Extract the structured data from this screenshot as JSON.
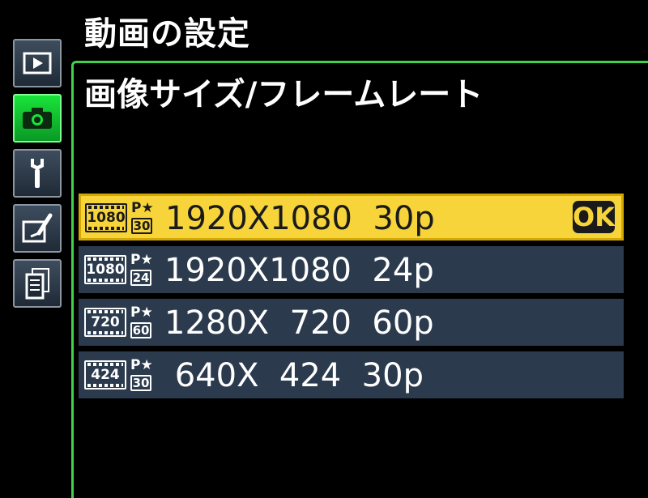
{
  "header": {
    "title": "動画の設定"
  },
  "subtitle": "画像サイズ/フレームレート",
  "tabs": [
    {
      "icon": "playback-icon",
      "active": false
    },
    {
      "icon": "camera-icon",
      "active": true
    },
    {
      "icon": "wrench-icon",
      "active": false
    },
    {
      "icon": "retouch-icon",
      "active": false
    },
    {
      "icon": "list-icon",
      "active": false
    }
  ],
  "options": [
    {
      "resolution_badge": "1080",
      "frame_rate_badge": "30",
      "star": "P★",
      "label": "1920X1080  30p",
      "selected": true,
      "confirm": "OK"
    },
    {
      "resolution_badge": "1080",
      "frame_rate_badge": "24",
      "star": "P★",
      "label": "1920X1080  24p",
      "selected": false
    },
    {
      "resolution_badge": "720",
      "frame_rate_badge": "60",
      "star": "P★",
      "label": "1280X  720  60p",
      "selected": false
    },
    {
      "resolution_badge": "424",
      "frame_rate_badge": "30",
      "star": "P★",
      "label": " 640X  424  30p",
      "selected": false
    }
  ],
  "colors": {
    "accent_green": "#3fd14a",
    "selection_yellow": "#f6d43a",
    "row_background": "#2b3a4d",
    "background": "#000000"
  }
}
